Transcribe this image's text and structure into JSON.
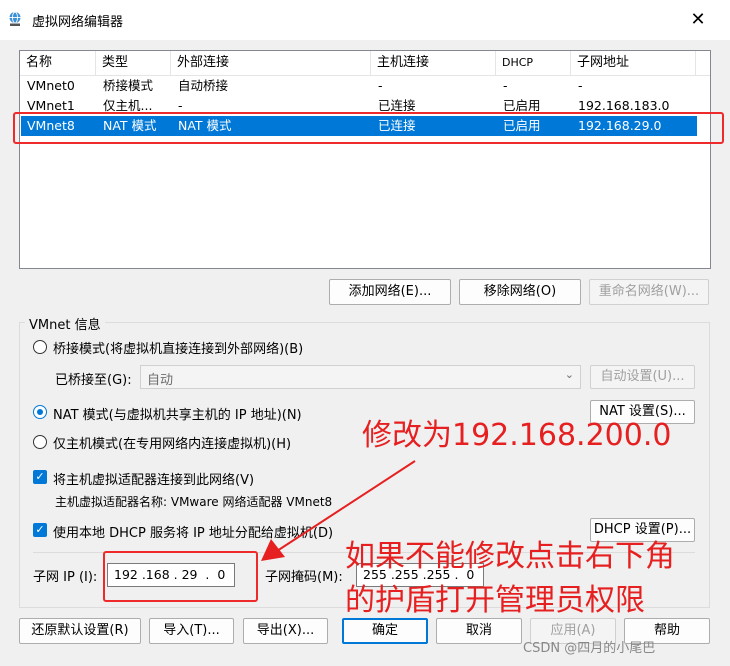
{
  "window": {
    "title": "虚拟网络编辑器",
    "close_glyph": "✕"
  },
  "table": {
    "headers": [
      "名称",
      "类型",
      "外部连接",
      "主机连接",
      "DHCP",
      "子网地址"
    ],
    "rows": [
      [
        "VMnet0",
        "桥接模式",
        "自动桥接",
        "-",
        "-",
        "-"
      ],
      [
        "VMnet1",
        "仅主机...",
        "-",
        "已连接",
        "已启用",
        "192.168.183.0"
      ],
      [
        "VMnet8",
        "NAT 模式",
        "NAT 模式",
        "已连接",
        "已启用",
        "192.168.29.0"
      ]
    ],
    "selected_row": 2
  },
  "buttons": {
    "add_network": "添加网络(E)...",
    "remove_network": "移除网络(O)",
    "rename_network": "重命名网络(W)...",
    "auto_settings": "自动设置(U)...",
    "nat_settings": "NAT 设置(S)...",
    "dhcp_settings": "DHCP 设置(P)...",
    "restore_defaults": "还原默认设置(R)",
    "import": "导入(T)...",
    "export": "导出(X)...",
    "ok": "确定",
    "cancel": "取消",
    "apply": "应用(A)",
    "help": "帮助"
  },
  "info": {
    "group_title": "VMnet 信息",
    "bridged_label": "桥接模式(将虚拟机直接连接到外部网络)(B)",
    "bridged_to_label": "已桥接至(G):",
    "bridged_to_value": "自动",
    "nat_label": "NAT 模式(与虚拟机共享主机的 IP 地址)(N)",
    "hostonly_label": "仅主机模式(在专用网络内连接虚拟机)(H)",
    "connect_adapter_label": "将主机虚拟适配器连接到此网络(V)",
    "adapter_name_label": "主机虚拟适配器名称: VMware 网络适配器 VMnet8",
    "use_dhcp_label": "使用本地 DHCP 服务将 IP 地址分配给虚拟机(D)",
    "subnet_ip_label": "子网 IP (I):",
    "subnet_ip_value": "192 .168 . 29  .  0",
    "subnet_mask_label": "子网掩码(M):",
    "subnet_mask_value": "255 .255 .255 .  0",
    "selected_mode": "nat",
    "connect_adapter_checked": true,
    "use_dhcp_checked": true
  },
  "annotations": {
    "change_to": "修改为192.168.200.0",
    "admin_line1": "如果不能修改点击右下角",
    "admin_line2": "的护盾打开管理员权限",
    "color": "#e62020"
  },
  "watermark": "CSDN @四月的小尾巴",
  "colors": {
    "accent": "#0078d7",
    "annotation": "#ee2a2a"
  }
}
